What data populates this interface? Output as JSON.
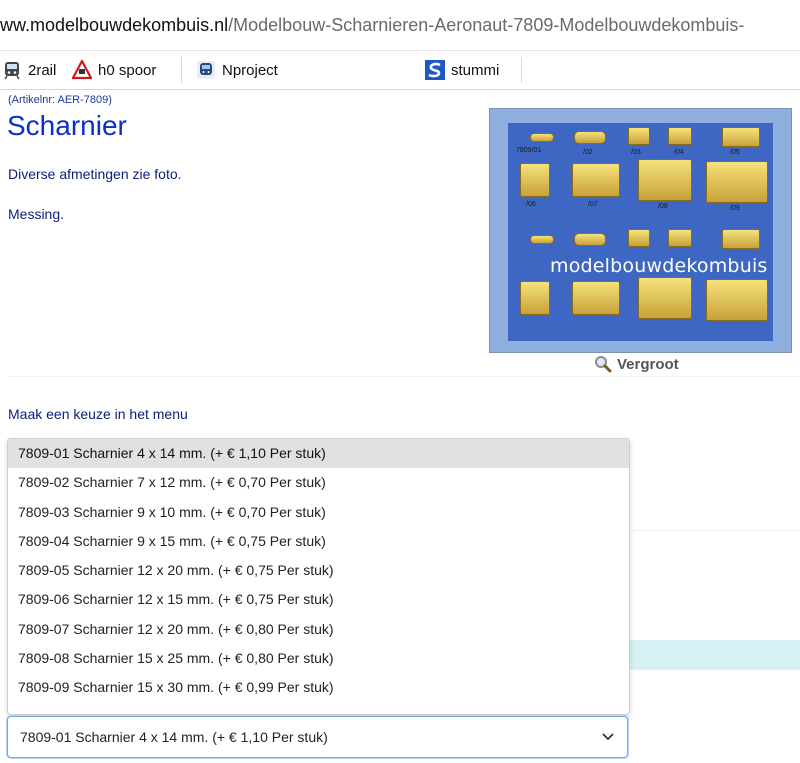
{
  "url": {
    "prefix": "ww.",
    "domain": "modelbouwdekombuis.nl",
    "path": "/Modelbouw-Scharnieren-Aeronaut-7809-Modelbouwdekombuis-"
  },
  "bookmarks": [
    {
      "label": "2rail",
      "icon": "train-front-icon"
    },
    {
      "label": "h0 spoor",
      "icon": "warning-triangle-icon"
    },
    {
      "label": "Nproject",
      "icon": "train-icon"
    },
    {
      "label": "stummi",
      "icon": "s-logo-icon"
    }
  ],
  "product": {
    "article_nr": "(Artikelnr: AER-7809)",
    "title": "Scharnier",
    "description_1": "Diverse afmetingen zie foto.",
    "description_2": "Messing.",
    "watermark": "modelbouwdekombuis",
    "zoom_label": "Vergroot",
    "photo_labels": [
      "7809/01",
      "/02",
      "/03",
      "/04",
      "/05",
      "/06",
      "/07",
      "/08",
      "/09"
    ]
  },
  "menu": {
    "prompt": "Maak een keuze in het menu",
    "options": [
      "7809-01 Scharnier 4 x 14 mm. (+ € 1,10 Per stuk)",
      "7809-02 Scharnier 7 x 12 mm. (+ € 0,70 Per stuk)",
      "7809-03 Scharnier 9 x 10 mm. (+ € 0,70 Per stuk)",
      "7809-04 Scharnier 9 x 15 mm. (+ € 0,75 Per stuk)",
      "7809-05 Scharnier 12 x 20 mm. (+ € 0,75 Per stuk)",
      "7809-06 Scharnier 12 x 15 mm. (+ € 0,75 Per stuk)",
      "7809-07 Scharnier 12 x 20 mm. (+ € 0,80 Per stuk)",
      "7809-08 Scharnier 15 x 25 mm. (+ € 0,80 Per stuk)",
      "7809-09 Scharnier 15 x 30 mm. (+ € 0,99 Per stuk)"
    ],
    "selected": "7809-01 Scharnier 4 x 14 mm. (+ € 1,10 Per stuk)"
  },
  "colors": {
    "title_blue": "#0b30c9",
    "text_navy": "#0d1d7a",
    "photo_bg": "#3d67c3",
    "highlight": "#e1e1e1"
  }
}
